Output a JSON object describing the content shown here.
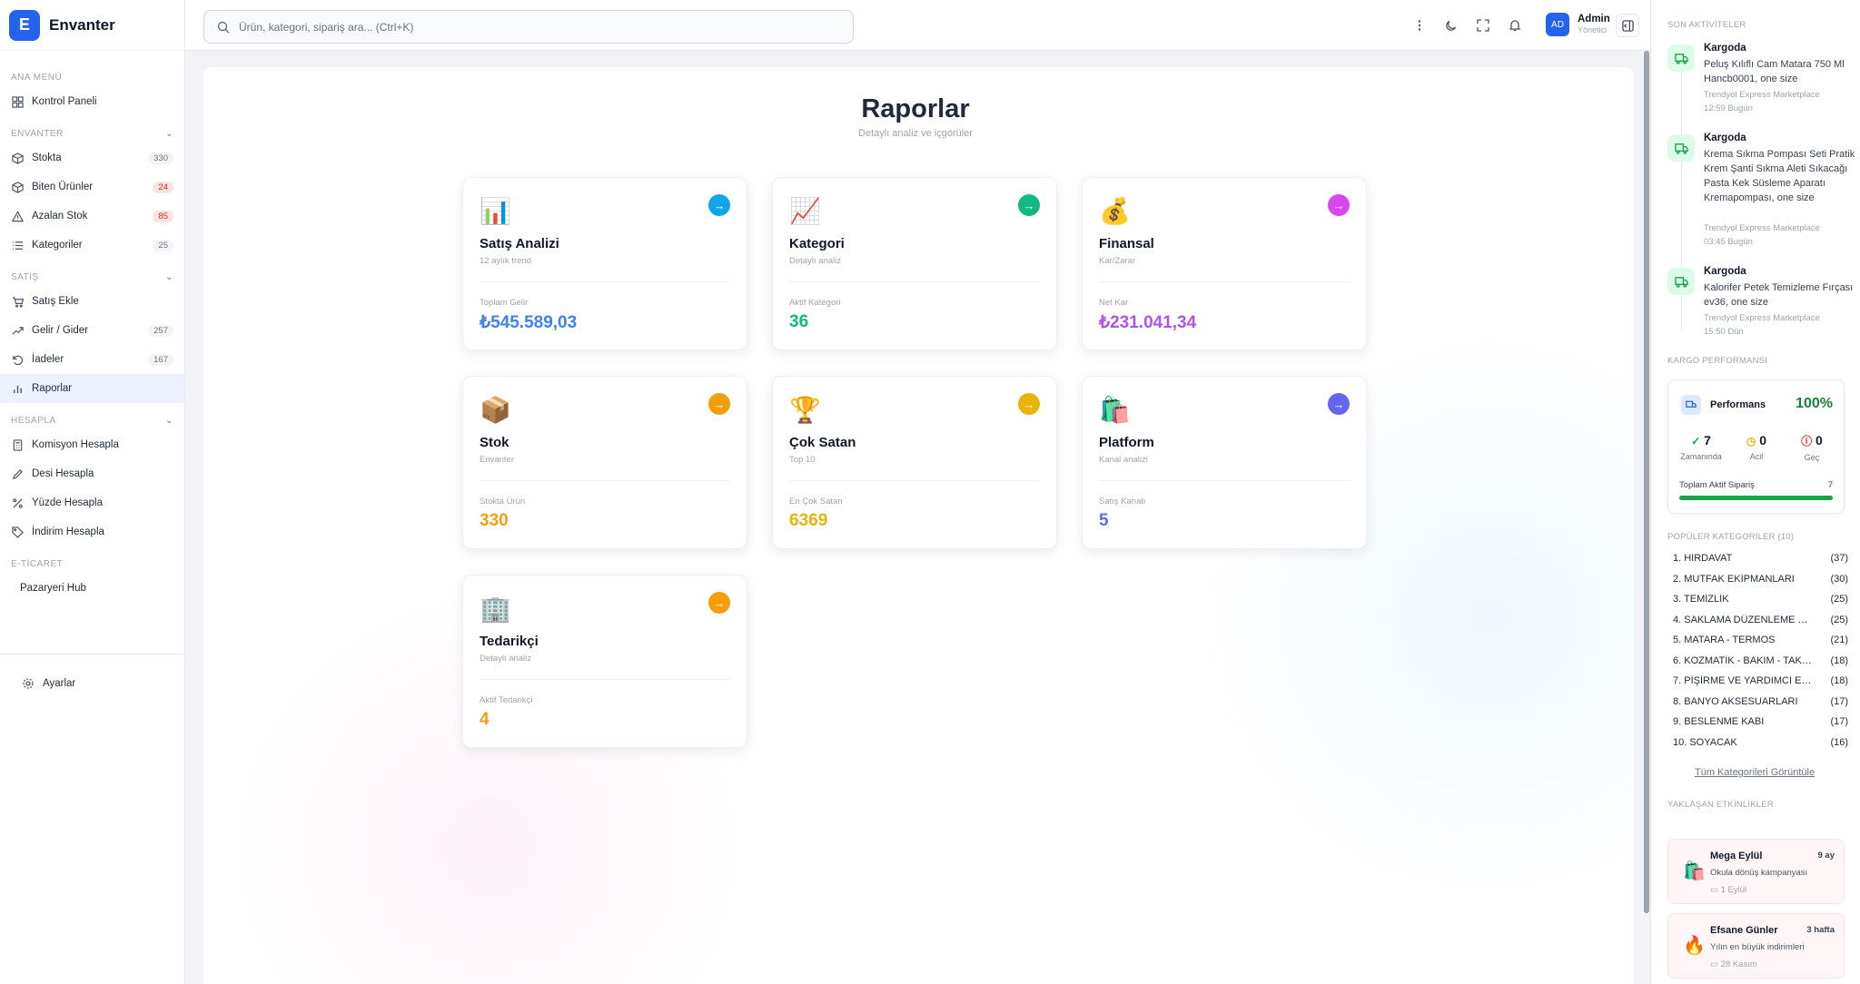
{
  "brand": {
    "logo_letter": "E",
    "name": "Envanter"
  },
  "sidebar": {
    "sections": {
      "main": "ANA MENÜ",
      "inventory": "ENVANTER",
      "sales": "SATIŞ",
      "calc": "HESAPLA",
      "ecommerce": "E-TİCARET"
    },
    "items": [
      {
        "label": "Kontrol Paneli",
        "icon": "dashboard-icon"
      },
      {
        "label": "Stokta",
        "badge": "330",
        "icon": "box-icon"
      },
      {
        "label": "Biten Ürünler",
        "badge": "24",
        "icon": "box-icon"
      },
      {
        "label": "Azalan Stok",
        "badge": "85",
        "icon": "warning-icon"
      },
      {
        "label": "Kategoriler",
        "badge": "25",
        "icon": "list-icon"
      },
      {
        "label": "Satış Ekle",
        "icon": "cart-icon"
      },
      {
        "label": "Gelir / Gider",
        "badge": "257",
        "icon": "trend-icon"
      },
      {
        "label": "İadeler",
        "badge": "167",
        "icon": "return-icon"
      },
      {
        "label": "Raporlar",
        "icon": "bar-chart-icon"
      },
      {
        "label": "Komisyon Hesapla",
        "icon": "calculator-icon"
      },
      {
        "label": "Desi Hesapla",
        "icon": "pencil-icon"
      },
      {
        "label": "Yüzde Hesapla",
        "icon": "percent-icon"
      },
      {
        "label": "İndirim Hesapla",
        "icon": "tag-icon"
      },
      {
        "label": "Pazaryeri Hub"
      }
    ],
    "settings_label": "Ayarlar"
  },
  "header": {
    "search_placeholder": "Ürün, kategori, sipariş ara... (Ctrl+K)",
    "user": {
      "initials": "AD",
      "name": "Admin",
      "role": "Yönetici"
    }
  },
  "page": {
    "title": "Raporlar",
    "subtitle": "Detaylı analiz ve içgörüler"
  },
  "cards": [
    {
      "emoji": "📊",
      "title": "Satış Analizi",
      "subtitle": "12 aylık trend",
      "metric_label": "Toplam Gelir",
      "metric_value": "₺545.589,03",
      "color": "#3b82f6",
      "btn": "#0ea5e9"
    },
    {
      "emoji": "📈",
      "title": "Kategori",
      "subtitle": "Detaylı analiz",
      "metric_label": "Aktif Kategori",
      "metric_value": "36",
      "color": "#10b981",
      "btn": "#10b981"
    },
    {
      "emoji": "💰",
      "title": "Finansal",
      "subtitle": "Kar/Zarar",
      "metric_label": "Net Kar",
      "metric_value": "₺231.041,34",
      "color": "#a855f7",
      "btn": "#d946ef"
    },
    {
      "emoji": "📦",
      "title": "Stok",
      "subtitle": "Envanter",
      "metric_label": "Stokta Ürün",
      "metric_value": "330",
      "color": "#f59e0b",
      "btn": "#f59e0b"
    },
    {
      "emoji": "🏆",
      "title": "Çok Satan",
      "subtitle": "Top 10",
      "metric_label": "En Çok Satan",
      "metric_value": "6369",
      "color": "#eab308",
      "btn": "#eab308"
    },
    {
      "emoji": "🛍️",
      "title": "Platform",
      "subtitle": "Kanal analizi",
      "metric_label": "Satış Kanalı",
      "metric_value": "5",
      "color": "#6366f1",
      "btn": "#6366f1"
    },
    {
      "emoji": "🏢",
      "title": "Tedarikçi",
      "subtitle": "Detaylı analiz",
      "metric_label": "Aktif Tedarikçi",
      "metric_value": "4",
      "color": "#f59e0b",
      "btn": "#f59e0b"
    }
  ],
  "right_panel": {
    "activities_title": "SON AKTİVİTELER",
    "activities": [
      {
        "title": "Kargoda",
        "desc": "Peluş Kılıflı Cam Matara 750 Ml Hancb0001, one size",
        "source": "Trendyol Express Marketplace",
        "time": "12:59 Bugün"
      },
      {
        "title": "Kargoda",
        "desc": "Krema Sıkma Pompası Seti Pratik Krem Şanti Sıkma Aleti Sıkacağı Pasta Kek Süsleme Aparatı Kremapompası, one size",
        "source": "Trendyol Express Marketplace",
        "time": "03:45 Bugün"
      },
      {
        "title": "Kargoda",
        "desc": "Kalorifer Petek Temizleme Fırçası ev36, one size",
        "source": "Trendyol Express Marketplace",
        "time": "15:50 Dün"
      }
    ],
    "performance_title": "KARGO PERFORMANSI",
    "performance": {
      "label": "Performans",
      "value": "100%",
      "stats": [
        {
          "value": "7",
          "label": "Zamanında",
          "icon": "check-circle-icon",
          "color": "#16a34a"
        },
        {
          "value": "0",
          "label": "Acil",
          "icon": "clock-icon",
          "color": "#eab308"
        },
        {
          "value": "0",
          "label": "Geç",
          "icon": "alert-circle-icon",
          "color": "#dc2626"
        }
      ],
      "total_label": "Toplam Aktif Sipariş",
      "total_value": "7",
      "progress": 1.0
    },
    "categories_title": "POPÜLER KATEGORİLER (10)",
    "categories": [
      {
        "name": "1. HIRDAVAT",
        "count": "(37)"
      },
      {
        "name": "2. MUTFAK EKİPMANLARI",
        "count": "(30)"
      },
      {
        "name": "3. TEMİZLİK",
        "count": "(25)"
      },
      {
        "name": "4. SAKLAMA DÜZENLEME ÜR...",
        "count": "(25)"
      },
      {
        "name": "5. MATARA - TERMOS",
        "count": "(21)"
      },
      {
        "name": "6. KOZMATİK - BAKIM - TAKI ...",
        "count": "(18)"
      },
      {
        "name": "7. PİŞİRME VE YARDIMCI EKİP...",
        "count": "(18)"
      },
      {
        "name": "8. BANYO AKSESUARLARI",
        "count": "(17)"
      },
      {
        "name": "9. BESLENME KABI",
        "count": "(17)"
      },
      {
        "name": "10. SOYACAK",
        "count": "(16)"
      }
    ],
    "all_categories_link": "Tüm Kategorileri Görüntüle",
    "events_title": "YAKLAŞAN ETKİNLİKLER",
    "events": [
      {
        "emoji": "🛍️",
        "title": "Mega Eylül",
        "when": "9 ay",
        "desc": "Okula dönüş kampanyası",
        "date": "1 Eylül"
      },
      {
        "emoji": "🔥",
        "title": "Efsane Günler",
        "when": "3 hafta",
        "desc": "Yılın en büyük indirimleri",
        "date": "28 Kasım"
      }
    ]
  }
}
